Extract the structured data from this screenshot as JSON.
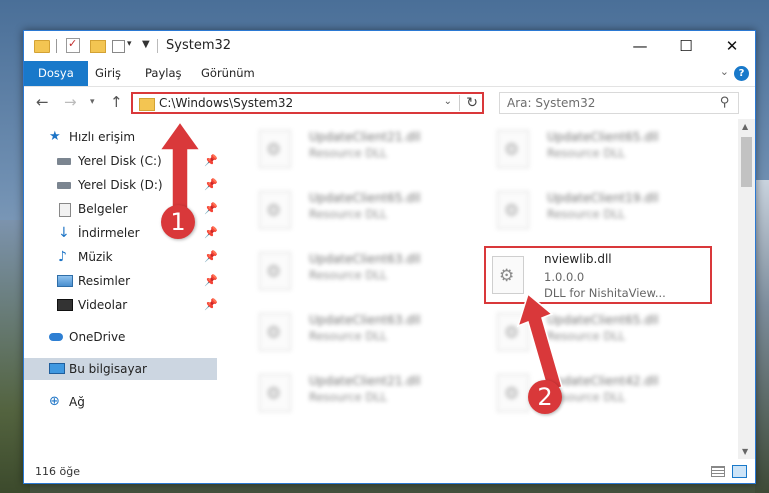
{
  "window": {
    "title": "System32",
    "controls": {
      "minimize": "—",
      "maximize": "☐",
      "close": "✕"
    }
  },
  "ribbon": {
    "tabs": [
      {
        "label": "Dosya",
        "active": true
      },
      {
        "label": "Giriş"
      },
      {
        "label": "Paylaş"
      },
      {
        "label": "Görünüm"
      }
    ],
    "help": "?"
  },
  "nav": {
    "back": "←",
    "forward": "→",
    "up": "↑",
    "address": "C:\\Windows\\System32",
    "search_placeholder": "Ara: System32"
  },
  "sidebar": {
    "items": [
      {
        "label": "Hızlı erişim",
        "icon": "star-icon"
      },
      {
        "label": "Yerel Disk (C:)",
        "icon": "disk-icon",
        "pinned": true
      },
      {
        "label": "Yerel Disk (D:)",
        "icon": "disk-icon",
        "pinned": true
      },
      {
        "label": "Belgeler",
        "icon": "documents-icon",
        "pinned": true
      },
      {
        "label": "İndirmeler",
        "icon": "download-icon",
        "pinned": true
      },
      {
        "label": "Müzik",
        "icon": "music-icon",
        "pinned": true
      },
      {
        "label": "Resimler",
        "icon": "pictures-icon",
        "pinned": true
      },
      {
        "label": "Videolar",
        "icon": "videos-icon",
        "pinned": true
      },
      {
        "label": "OneDrive",
        "icon": "onedrive-icon"
      },
      {
        "label": "Bu bilgisayar",
        "icon": "computer-icon",
        "selected": true
      },
      {
        "label": "Ağ",
        "icon": "network-icon"
      }
    ]
  },
  "files": [
    {
      "name": "UpdateClient21.dll",
      "type": "Resource DLL"
    },
    {
      "name": "UpdateClient65.dll",
      "type": "Resource DLL"
    },
    {
      "name": "UpdateClient65.dll",
      "type": "Resource DLL"
    },
    {
      "name": "UpdateClient19.dll",
      "type": "Resource DLL"
    },
    {
      "name": "UpdateClient63.dll",
      "type": "Resource DLL"
    },
    {
      "name": "nviewlib.dll",
      "version": "1.0.0.0",
      "type": "DLL for NishitaView..."
    },
    {
      "name": "UpdateClient63.dll",
      "type": "Resource DLL"
    },
    {
      "name": "UpdateClient65.dll",
      "type": "Resource DLL"
    },
    {
      "name": "UpdateClient21.dll",
      "type": "Resource DLL"
    },
    {
      "name": "UpdateClient42.dll",
      "type": "Resource DLL"
    }
  ],
  "status": {
    "count": "116 öğe"
  },
  "annotations": {
    "step1": "1",
    "step2": "2",
    "color": "#d9383a"
  }
}
